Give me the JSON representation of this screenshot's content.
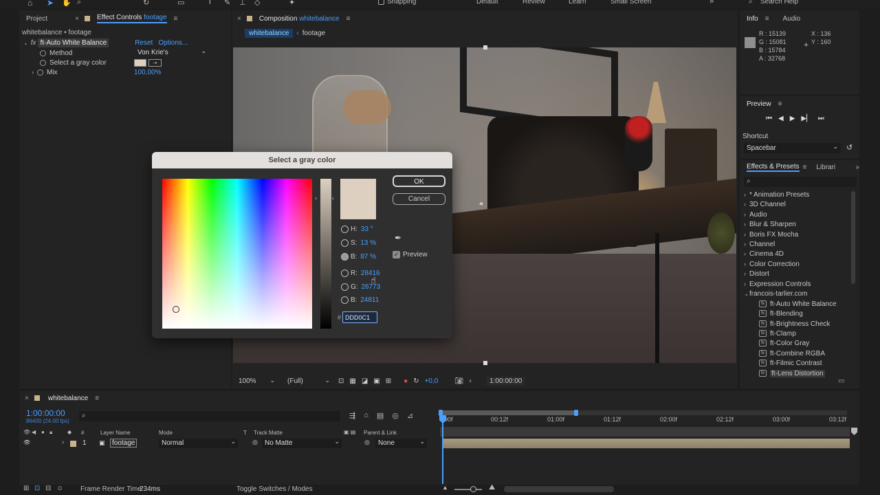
{
  "toolbar": {
    "snapping": "Snapping",
    "workspaces": [
      "Default",
      "Review",
      "Learn",
      "Small Screen"
    ],
    "search_help": "Search Help"
  },
  "project_tab": "Project",
  "effect_controls": {
    "tab_prefix": "Effect Controls",
    "tab_layer": "footage",
    "breadcrumb": "whitebalance • footage",
    "fx_badge": "fx",
    "effect_name": "ft-Auto White Balance",
    "reset": "Reset",
    "options": "Options...",
    "method_label": "Method",
    "method_value": "Von Krie's",
    "gray_label": "Select a gray color",
    "mix_label": "Mix",
    "mix_value": "100,00%"
  },
  "composition": {
    "tab_prefix": "Composition",
    "tab_name": "whitebalance",
    "crumb_1": "whitebalance",
    "crumb_2": "footage",
    "zoom": "100%",
    "resolution": "(Full)",
    "exposure": "+0,0",
    "timecode": "1:00:00:00"
  },
  "dialog": {
    "title": "Select a gray color",
    "ok": "OK",
    "cancel": "Cancel",
    "h_label": "H:",
    "h_value": "33 °",
    "s_label": "S:",
    "s_value": "13 %",
    "b_label": "B:",
    "b_value": "87 %",
    "r_label": "R:",
    "r_value": "28416",
    "g_label": "G:",
    "g_value": "26773",
    "bl_label": "B:",
    "bl_value": "24811",
    "hash": "#",
    "hex_value": "DDD0C1",
    "preview_label": "Preview",
    "swatch_color": "#ddd0c1"
  },
  "info": {
    "tab": "Info",
    "audio_tab": "Audio",
    "r": "R : 15139",
    "g": "G : 15081",
    "b": "B : 15784",
    "a": "A : 32768",
    "x": "X : 136",
    "y": "Y : 160"
  },
  "preview": {
    "title": "Preview",
    "shortcut_label": "Shortcut",
    "shortcut_value": "Spacebar"
  },
  "effects_presets": {
    "tab": "Effects & Presets",
    "libraries_tab": "Librari",
    "categories": [
      "* Animation Presets",
      "3D Channel",
      "Audio",
      "Blur & Sharpen",
      "Boris FX Mocha",
      "Channel",
      "Cinema 4D",
      "Color Correction",
      "Distort",
      "Expression Controls",
      "francois-tarlier.com"
    ],
    "items": [
      "ft-Auto White Balance",
      "ft-Blending",
      "ft-Brightness Check",
      "ft-Clamp",
      "ft-Color Gray",
      "ft-Combine RGBA",
      "ft-Filmic Contrast",
      "ft-Lens Distortion"
    ]
  },
  "timeline": {
    "tab": "whitebalance",
    "timecode": "1:00:00:00",
    "frames": "86400 (24.00 fps)",
    "col_layer_name": "Layer Name",
    "col_mode": "Mode",
    "col_t": "T",
    "col_track_matte": "Track Matte",
    "col_parent": "Parent & Link",
    "col_num": "#",
    "layer_num": "1",
    "layer_name": "footage",
    "layer_mode": "Normal",
    "layer_matte": "No Matte",
    "layer_parent": "None",
    "ruler": [
      "00f",
      "00:12f",
      "01:00f",
      "01:12f",
      "02:00f",
      "02:12f",
      "03:00f",
      "03:12f"
    ],
    "frame_render_label": "Frame Render Time",
    "frame_render_value": "234ms",
    "toggle_label": "Toggle Switches / Modes"
  }
}
